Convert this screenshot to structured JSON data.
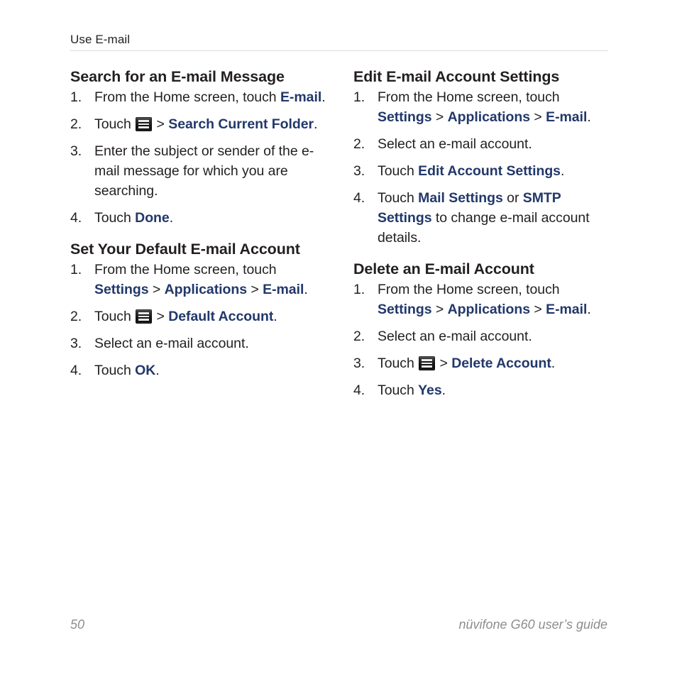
{
  "page": {
    "running_head": "Use E-mail",
    "folio": "50",
    "guide_title": "nüvifone G60 user’s guide"
  },
  "icons": {
    "menu": "menu-icon"
  },
  "colors": {
    "ui_term": "#22386a",
    "body_text": "#231f20",
    "footer_text": "#8d8d8d",
    "rule": "#b9b9b9"
  },
  "columns": {
    "left": {
      "sections": [
        {
          "title": "Search for an E-mail Message",
          "steps": [
            {
              "num": "1.",
              "parts": [
                {
                  "type": "text",
                  "value": "From the Home screen, touch "
                },
                {
                  "type": "ui",
                  "value": "E-mail"
                },
                {
                  "type": "text",
                  "value": "."
                }
              ]
            },
            {
              "num": "2.",
              "parts": [
                {
                  "type": "text",
                  "value": "Touch "
                },
                {
                  "type": "icon",
                  "value": "menu-icon"
                },
                {
                  "type": "sep",
                  "value": " > "
                },
                {
                  "type": "ui",
                  "value": "Search Current Folder"
                },
                {
                  "type": "text",
                  "value": "."
                }
              ]
            },
            {
              "num": "3.",
              "parts": [
                {
                  "type": "text",
                  "value": "Enter the subject or sender of the e-mail message for which you are searching."
                }
              ]
            },
            {
              "num": "4.",
              "parts": [
                {
                  "type": "text",
                  "value": "Touch "
                },
                {
                  "type": "ui",
                  "value": "Done"
                },
                {
                  "type": "text",
                  "value": "."
                }
              ]
            }
          ]
        },
        {
          "title": "Set Your Default E-mail Account",
          "steps": [
            {
              "num": "1.",
              "parts": [
                {
                  "type": "text",
                  "value": "From the Home screen, touch "
                },
                {
                  "type": "ui",
                  "value": "Settings"
                },
                {
                  "type": "sep",
                  "value": " > "
                },
                {
                  "type": "ui",
                  "value": "Applications"
                },
                {
                  "type": "sep",
                  "value": " > "
                },
                {
                  "type": "ui",
                  "value": "E-mail"
                },
                {
                  "type": "text",
                  "value": "."
                }
              ]
            },
            {
              "num": "2.",
              "parts": [
                {
                  "type": "text",
                  "value": "Touch "
                },
                {
                  "type": "icon",
                  "value": "menu-icon"
                },
                {
                  "type": "sep",
                  "value": " > "
                },
                {
                  "type": "ui",
                  "value": "Default Account"
                },
                {
                  "type": "text",
                  "value": "."
                }
              ]
            },
            {
              "num": "3.",
              "parts": [
                {
                  "type": "text",
                  "value": "Select an e-mail account."
                }
              ]
            },
            {
              "num": "4.",
              "parts": [
                {
                  "type": "text",
                  "value": "Touch "
                },
                {
                  "type": "ui",
                  "value": "OK"
                },
                {
                  "type": "text",
                  "value": "."
                }
              ]
            }
          ]
        }
      ]
    },
    "right": {
      "sections": [
        {
          "title": "Edit E-mail Account Settings",
          "steps": [
            {
              "num": "1.",
              "parts": [
                {
                  "type": "text",
                  "value": "From the Home screen, touch "
                },
                {
                  "type": "ui",
                  "value": "Settings"
                },
                {
                  "type": "sep",
                  "value": " > "
                },
                {
                  "type": "ui",
                  "value": "Applications"
                },
                {
                  "type": "sep",
                  "value": " > "
                },
                {
                  "type": "ui",
                  "value": "E-mail"
                },
                {
                  "type": "text",
                  "value": "."
                }
              ]
            },
            {
              "num": "2.",
              "parts": [
                {
                  "type": "text",
                  "value": "Select an e-mail account."
                }
              ]
            },
            {
              "num": "3.",
              "parts": [
                {
                  "type": "text",
                  "value": "Touch "
                },
                {
                  "type": "ui",
                  "value": "Edit Account Settings"
                },
                {
                  "type": "text",
                  "value": "."
                }
              ]
            },
            {
              "num": "4.",
              "parts": [
                {
                  "type": "text",
                  "value": "Touch "
                },
                {
                  "type": "ui",
                  "value": "Mail Settings"
                },
                {
                  "type": "text",
                  "value": " or "
                },
                {
                  "type": "ui",
                  "value": "SMTP Settings"
                },
                {
                  "type": "text",
                  "value": " to change e-mail account details."
                }
              ]
            }
          ]
        },
        {
          "title": "Delete an E-mail Account",
          "steps": [
            {
              "num": "1.",
              "parts": [
                {
                  "type": "text",
                  "value": "From the Home screen, touch "
                },
                {
                  "type": "ui",
                  "value": "Settings"
                },
                {
                  "type": "sep",
                  "value": " > "
                },
                {
                  "type": "ui",
                  "value": "Applications"
                },
                {
                  "type": "sep",
                  "value": " > "
                },
                {
                  "type": "ui",
                  "value": "E-mail"
                },
                {
                  "type": "text",
                  "value": "."
                }
              ]
            },
            {
              "num": "2.",
              "parts": [
                {
                  "type": "text",
                  "value": "Select an e-mail account."
                }
              ]
            },
            {
              "num": "3.",
              "parts": [
                {
                  "type": "text",
                  "value": "Touch "
                },
                {
                  "type": "icon",
                  "value": "menu-icon"
                },
                {
                  "type": "sep",
                  "value": " > "
                },
                {
                  "type": "ui",
                  "value": "Delete Account"
                },
                {
                  "type": "text",
                  "value": "."
                }
              ]
            },
            {
              "num": "4.",
              "parts": [
                {
                  "type": "text",
                  "value": "Touch "
                },
                {
                  "type": "ui",
                  "value": "Yes"
                },
                {
                  "type": "text",
                  "value": "."
                }
              ]
            }
          ]
        }
      ]
    }
  }
}
